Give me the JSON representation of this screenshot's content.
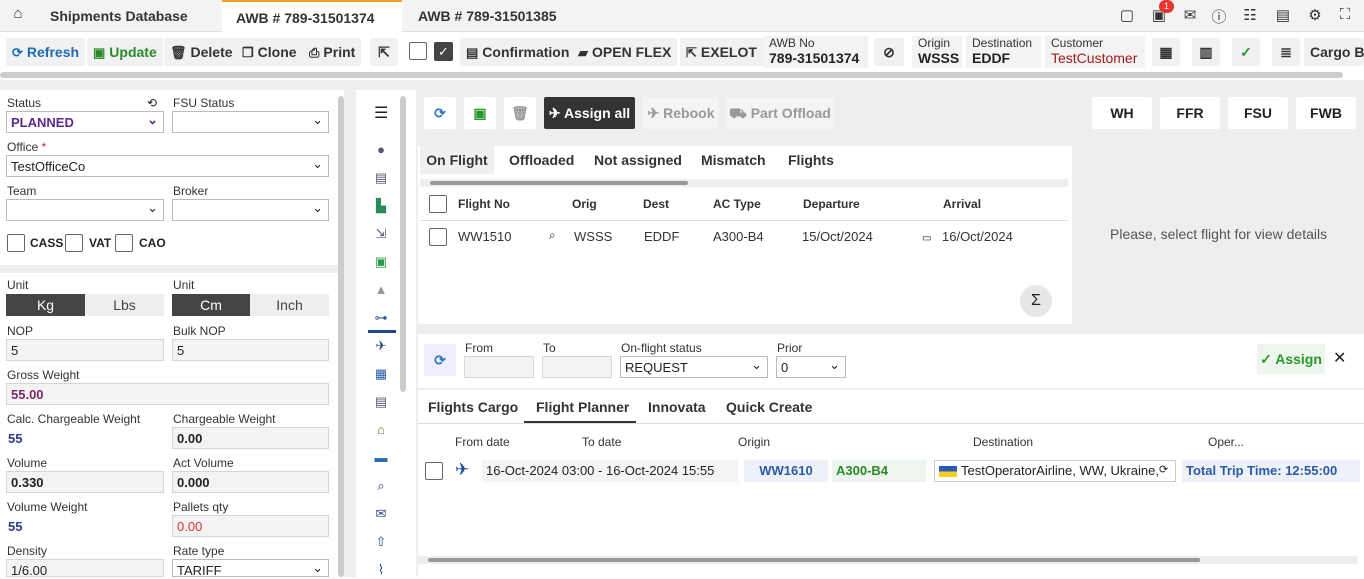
{
  "tabs": [
    {
      "label": "Shipments Database"
    },
    {
      "label": "AWB # 789-31501374"
    },
    {
      "label": "AWB # 789-31501385"
    }
  ],
  "notification_count": "1",
  "toolbar": {
    "refresh": "Refresh",
    "update": "Update",
    "delete": "Delete",
    "clone": "Clone",
    "print": "Print",
    "confirmation": "Confirmation",
    "open_flex": "OPEN FLEX",
    "exelot": "EXELOT",
    "awb_no_label": "AWB No",
    "awb_no": "789-31501374",
    "origin_label": "Origin",
    "origin": "WSSS",
    "destination_label": "Destination",
    "destination": "EDDF",
    "customer_label": "Customer",
    "customer": "TestCustomer",
    "cargo_bo": "Cargo Bo"
  },
  "left": {
    "status_label": "Status",
    "status": "PLANNED",
    "fsu_label": "FSU Status",
    "fsu": "",
    "office_label": "Office",
    "office": "TestOfficeCo",
    "team_label": "Team",
    "broker_label": "Broker",
    "cass": "CASS",
    "vat": "VAT",
    "cao": "CAO",
    "unit_label": "Unit",
    "kg": "Kg",
    "lbs": "Lbs",
    "cm": "Cm",
    "inch": "Inch",
    "nop_label": "NOP",
    "nop": "5",
    "bulk_nop_label": "Bulk NOP",
    "bulk_nop": "5",
    "gross_weight_label": "Gross Weight",
    "gross_weight": "55.00",
    "calc_cw_label": "Calc. Chargeable Weight",
    "calc_cw": "55",
    "cw_label": "Chargeable Weight",
    "cw": "0.00",
    "volume_label": "Volume",
    "volume": "0.330",
    "act_volume_label": "Act Volume",
    "act_volume": "0.000",
    "volume_weight_label": "Volume Weight",
    "volume_weight": "55",
    "pallets_label": "Pallets qty",
    "pallets": "0.00",
    "density_label": "Density",
    "density": "1/6.00",
    "rate_type_label": "Rate type",
    "rate_type": "TARIFF"
  },
  "right": {
    "assign_all": "Assign all",
    "rebook": "Rebook",
    "part_offload": "Part Offload",
    "wh": "WH",
    "ffr": "FFR",
    "fsu": "FSU",
    "fwb": "FWB",
    "subtabs": [
      "On Flight",
      "Offloaded",
      "Not assigned",
      "Mismatch",
      "Flights"
    ],
    "columns": [
      "Flight No",
      "Orig",
      "Dest",
      "AC Type",
      "Departure",
      "Arrival"
    ],
    "row": {
      "flight": "WW1510",
      "orig": "WSSS",
      "dest": "EDDF",
      "ac": "A300-B4",
      "dep": "15/Oct/2024",
      "arr": "16/Oct/2024"
    },
    "placeholder": "Please, select flight for view details",
    "from_label": "From",
    "to_label": "To",
    "status_label": "On-flight status",
    "status_value": "REQUEST",
    "prior_label": "Prior",
    "prior_value": "0",
    "assign": "Assign",
    "bottom_tabs": [
      "Flights Cargo",
      "Flight Planner",
      "Innovata",
      "Quick Create"
    ],
    "planner_cols": [
      "From date",
      "To date",
      "Origin",
      "Destination",
      "Oper..."
    ],
    "planner_row": {
      "time": "16-Oct-2024 03:00 - 16-Oct-2024 15:55",
      "flight": "WW1610",
      "ac": "A300-B4",
      "operator": "TestOperatorAirline, WW, Ukraine,",
      "total": "Total Trip Time: 12:55:00"
    }
  }
}
